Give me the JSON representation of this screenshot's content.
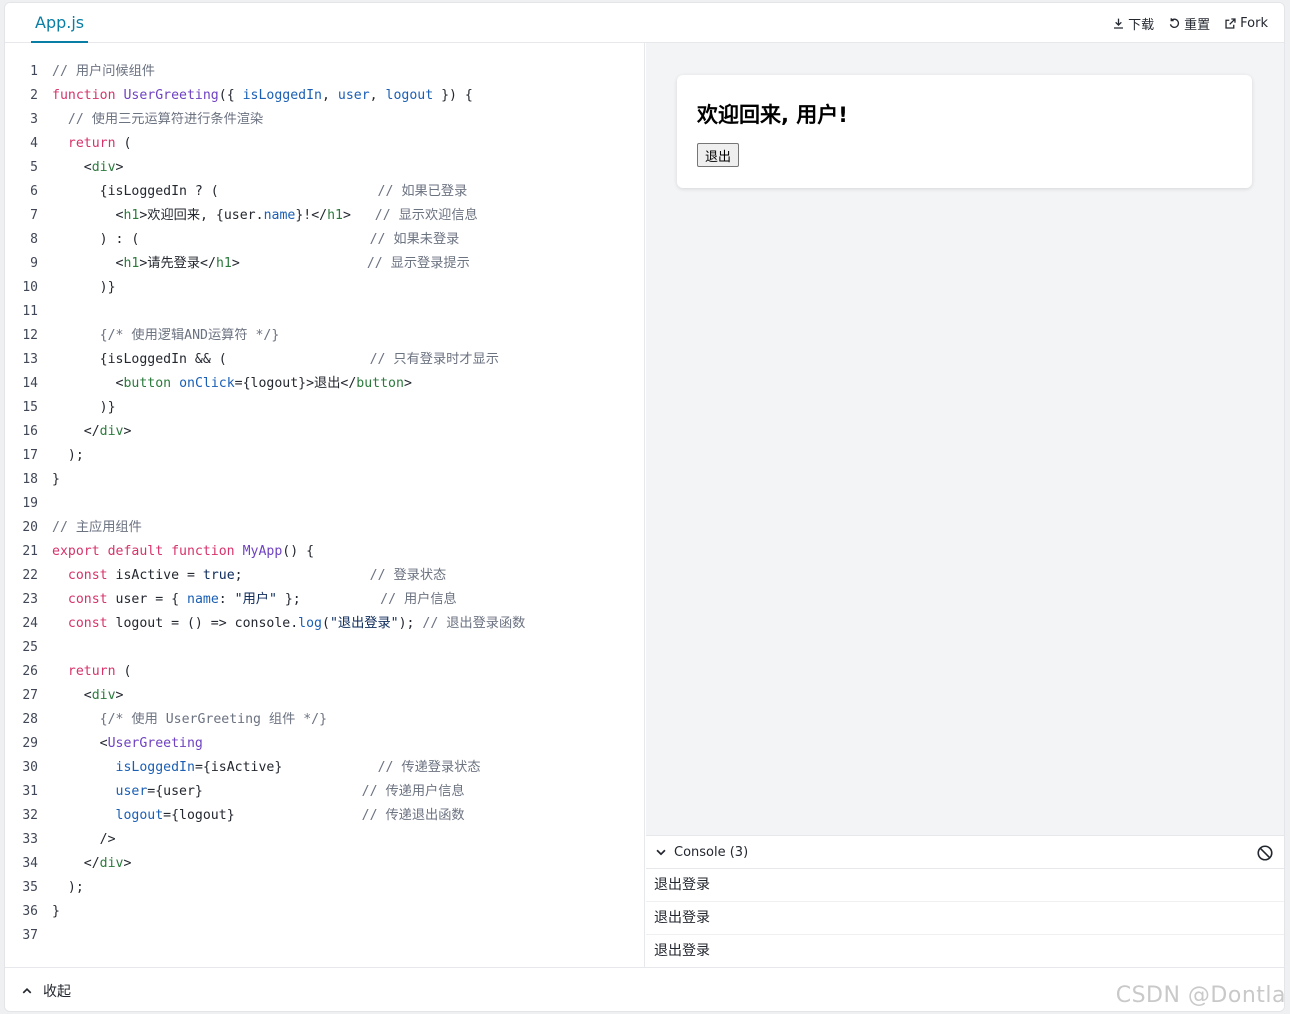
{
  "header": {
    "tab": "App.js",
    "actions": {
      "download": "下载",
      "reset": "重置",
      "fork": "Fork"
    }
  },
  "code_lines": [
    [
      [
        "cm",
        "// 用户问候组件"
      ]
    ],
    [
      [
        "kw",
        "function "
      ],
      [
        "fn",
        "UserGreeting"
      ],
      [
        "tx",
        "({ "
      ],
      [
        "at",
        "isLoggedIn"
      ],
      [
        "tx",
        ", "
      ],
      [
        "at",
        "user"
      ],
      [
        "tx",
        ", "
      ],
      [
        "at",
        "logout"
      ],
      [
        "tx",
        " }) {"
      ]
    ],
    [
      [
        "tx",
        "  "
      ],
      [
        "cm",
        "// 使用三元运算符进行条件渲染"
      ]
    ],
    [
      [
        "tx",
        "  "
      ],
      [
        "kw",
        "return"
      ],
      [
        "tx",
        " ("
      ]
    ],
    [
      [
        "tx",
        "    <"
      ],
      [
        "tg",
        "div"
      ],
      [
        "tx",
        ">"
      ]
    ],
    [
      [
        "tx",
        "      {isLoggedIn ? (                    "
      ],
      [
        "cm",
        "// 如果已登录"
      ]
    ],
    [
      [
        "tx",
        "        <"
      ],
      [
        "tg",
        "h1"
      ],
      [
        "tx",
        ">欢迎回来, {user."
      ],
      [
        "at",
        "name"
      ],
      [
        "tx",
        "}!</"
      ],
      [
        "tg",
        "h1"
      ],
      [
        "tx",
        ">   "
      ],
      [
        "cm",
        "// 显示欢迎信息"
      ]
    ],
    [
      [
        "tx",
        "      ) : (                             "
      ],
      [
        "cm",
        "// 如果未登录"
      ]
    ],
    [
      [
        "tx",
        "        <"
      ],
      [
        "tg",
        "h1"
      ],
      [
        "tx",
        ">请先登录</"
      ],
      [
        "tg",
        "h1"
      ],
      [
        "tx",
        ">                "
      ],
      [
        "cm",
        "// 显示登录提示"
      ]
    ],
    [
      [
        "tx",
        "      )}"
      ]
    ],
    [],
    [
      [
        "tx",
        "      "
      ],
      [
        "cm",
        "{/* 使用逻辑AND运算符 */}"
      ]
    ],
    [
      [
        "tx",
        "      {isLoggedIn && (                  "
      ],
      [
        "cm",
        "// 只有登录时才显示"
      ]
    ],
    [
      [
        "tx",
        "        <"
      ],
      [
        "tg",
        "button"
      ],
      [
        "tx",
        " "
      ],
      [
        "at",
        "onClick"
      ],
      [
        "tx",
        "={logout}>退出</"
      ],
      [
        "tg",
        "button"
      ],
      [
        "tx",
        ">"
      ]
    ],
    [
      [
        "tx",
        "      )}"
      ]
    ],
    [
      [
        "tx",
        "    </"
      ],
      [
        "tg",
        "div"
      ],
      [
        "tx",
        ">"
      ]
    ],
    [
      [
        "tx",
        "  );"
      ]
    ],
    [
      [
        "tx",
        "}"
      ]
    ],
    [],
    [
      [
        "cm",
        "// 主应用组件"
      ]
    ],
    [
      [
        "kw",
        "export default function "
      ],
      [
        "fn",
        "MyApp"
      ],
      [
        "tx",
        "() {"
      ]
    ],
    [
      [
        "tx",
        "  "
      ],
      [
        "kw",
        "const"
      ],
      [
        "tx",
        " isActive = "
      ],
      [
        "str",
        "true"
      ],
      [
        "tx",
        ";                "
      ],
      [
        "cm",
        "// 登录状态"
      ]
    ],
    [
      [
        "tx",
        "  "
      ],
      [
        "kw",
        "const"
      ],
      [
        "tx",
        " user = { "
      ],
      [
        "at",
        "name"
      ],
      [
        "tx",
        ": "
      ],
      [
        "str",
        "\"用户\""
      ],
      [
        "tx",
        " };          "
      ],
      [
        "cm",
        "// 用户信息"
      ]
    ],
    [
      [
        "tx",
        "  "
      ],
      [
        "kw",
        "const"
      ],
      [
        "tx",
        " logout = () => console."
      ],
      [
        "at",
        "log"
      ],
      [
        "tx",
        "("
      ],
      [
        "str",
        "\"退出登录\""
      ],
      [
        "tx",
        "); "
      ],
      [
        "cm",
        "// 退出登录函数"
      ]
    ],
    [],
    [
      [
        "tx",
        "  "
      ],
      [
        "kw",
        "return"
      ],
      [
        "tx",
        " ("
      ]
    ],
    [
      [
        "tx",
        "    <"
      ],
      [
        "tg",
        "div"
      ],
      [
        "tx",
        ">"
      ]
    ],
    [
      [
        "tx",
        "      "
      ],
      [
        "cm",
        "{/* 使用 UserGreeting 组件 */}"
      ]
    ],
    [
      [
        "tx",
        "      <"
      ],
      [
        "fn",
        "UserGreeting"
      ]
    ],
    [
      [
        "tx",
        "        "
      ],
      [
        "at",
        "isLoggedIn"
      ],
      [
        "tx",
        "={isActive}            "
      ],
      [
        "cm",
        "// 传递登录状态"
      ]
    ],
    [
      [
        "tx",
        "        "
      ],
      [
        "at",
        "user"
      ],
      [
        "tx",
        "={user}                    "
      ],
      [
        "cm",
        "// 传递用户信息"
      ]
    ],
    [
      [
        "tx",
        "        "
      ],
      [
        "at",
        "logout"
      ],
      [
        "tx",
        "={logout}                "
      ],
      [
        "cm",
        "// 传递退出函数"
      ]
    ],
    [
      [
        "tx",
        "      />"
      ]
    ],
    [
      [
        "tx",
        "    </"
      ],
      [
        "tg",
        "div"
      ],
      [
        "tx",
        ">"
      ]
    ],
    [
      [
        "tx",
        "  );"
      ]
    ],
    [
      [
        "tx",
        "}"
      ]
    ],
    []
  ],
  "preview": {
    "heading": "欢迎回来, 用户!",
    "button": "退出"
  },
  "console": {
    "title": "Console (3)",
    "logs": [
      "退出登录",
      "退出登录",
      "退出登录"
    ]
  },
  "footer": {
    "collapse": "收起"
  },
  "watermark": "CSDN @Dontla"
}
